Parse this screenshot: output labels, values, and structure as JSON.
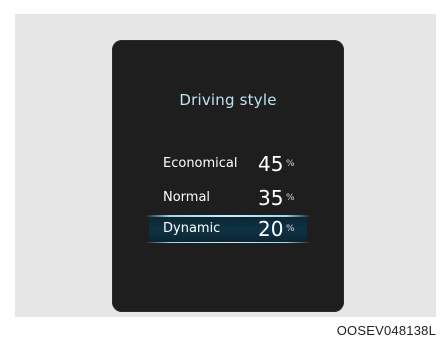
{
  "display": {
    "title": "Driving style",
    "rows": [
      {
        "label": "Economical",
        "value": "45",
        "unit": "%",
        "percent": 45,
        "selected": false
      },
      {
        "label": "Normal",
        "value": "35",
        "unit": "%",
        "percent": 35,
        "selected": false
      },
      {
        "label": "Dynamic",
        "value": "20",
        "unit": "%",
        "percent": 20,
        "selected": true
      }
    ]
  },
  "caption": "OOSEV048138L",
  "colors": {
    "screen_background": "#1e1e1e",
    "frame_background": "#e6e6e6",
    "title_text": "#bfe2f0",
    "highlight_line": "#9fd8ec",
    "highlight_fill": "#0e3344"
  }
}
